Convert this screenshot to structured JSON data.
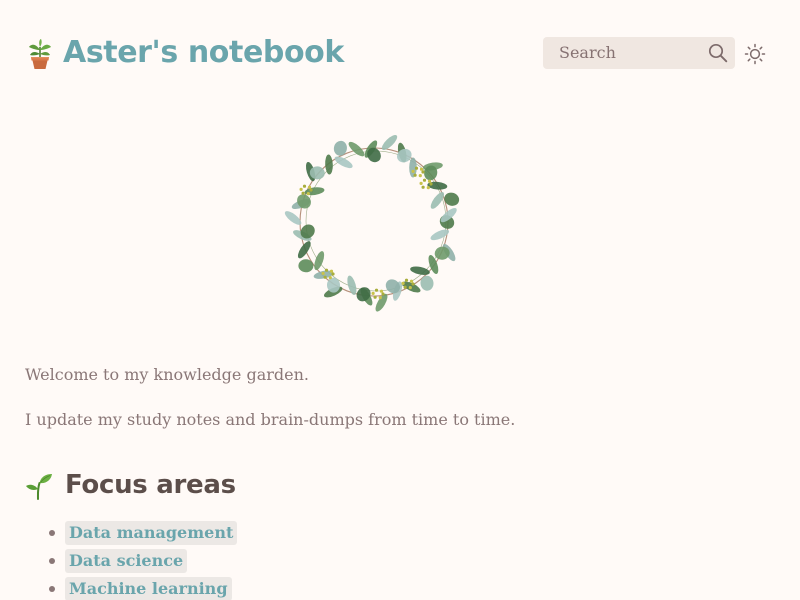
{
  "header": {
    "site_title": "Aster's notebook",
    "logo_icon": "potted-plant-icon",
    "search": {
      "placeholder": "Search",
      "icon": "search-icon"
    },
    "theme_toggle_icon": "sun-icon"
  },
  "main": {
    "hero_image": "leaf-wreath",
    "paragraphs": [
      "Welcome to my knowledge garden.",
      "I update my study notes and brain-dumps from time to time."
    ],
    "focus_section": {
      "icon": "seedling-icon",
      "title": "Focus areas",
      "items": [
        {
          "label": "Data management"
        },
        {
          "label": "Data science"
        },
        {
          "label": "Machine learning"
        }
      ]
    }
  },
  "colors": {
    "background": "#fffaf7",
    "accent": "#6aa5ac",
    "text": "#8a7777",
    "heading": "#5c4e4a",
    "search_background": "#f0e7e1",
    "link_background": "#ece8e5"
  }
}
